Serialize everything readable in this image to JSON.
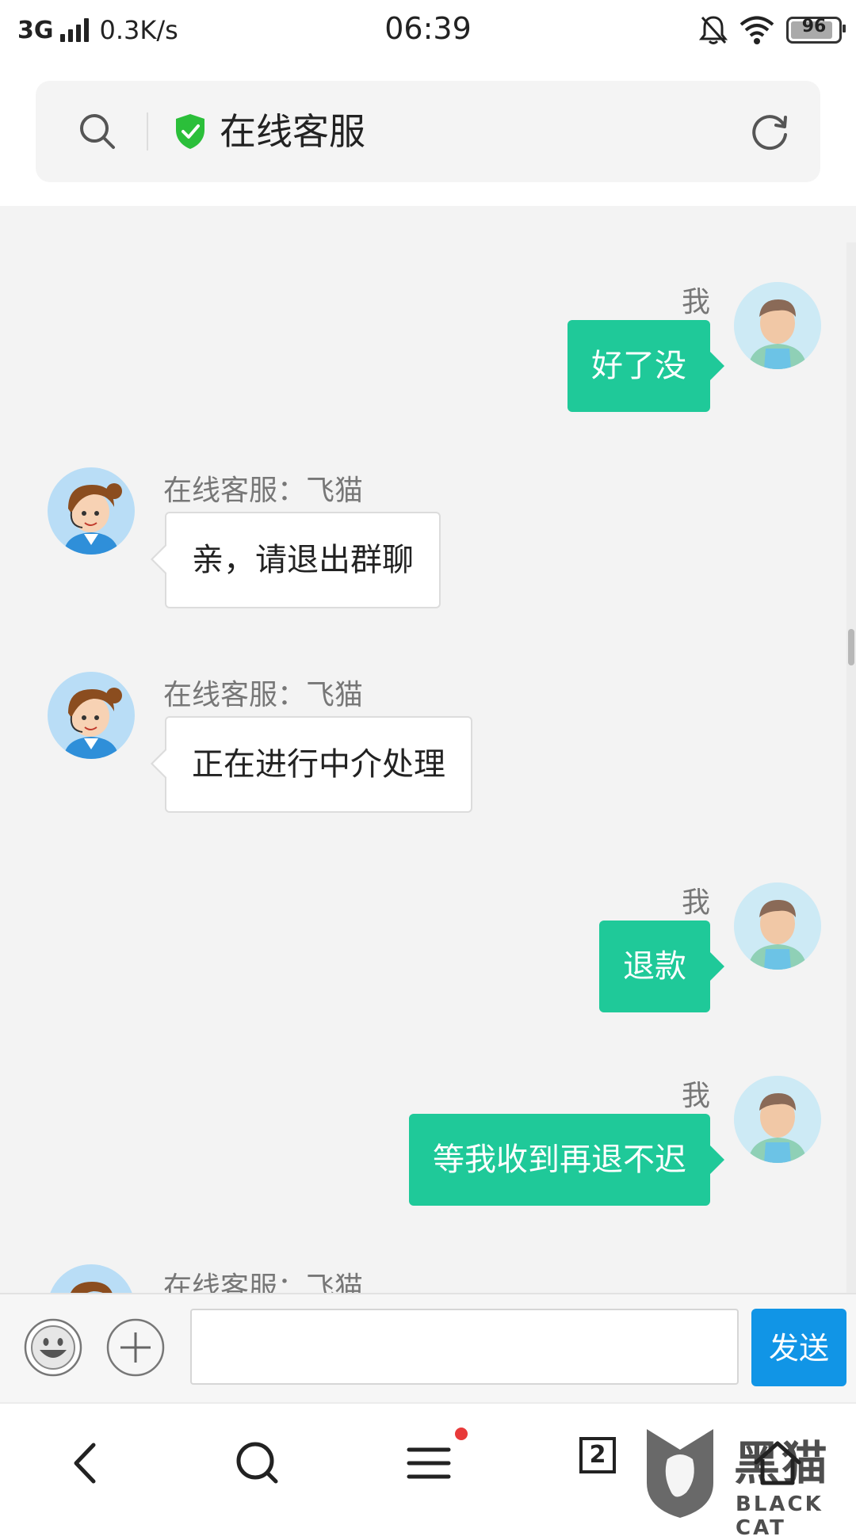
{
  "status_bar": {
    "network": "3G",
    "speed": "0.3K/s",
    "time": "06:39",
    "battery": "96",
    "icons": [
      "signal-icon",
      "bell-muted-icon",
      "wifi-icon",
      "battery-icon"
    ]
  },
  "address_bar": {
    "title": "在线客服",
    "icons": [
      "search-icon",
      "shield-check-icon",
      "refresh-icon"
    ],
    "shield_color": "#2bbf3a"
  },
  "chat": {
    "messages": [
      {
        "sender": "me",
        "name": "我",
        "text": "好了没"
      },
      {
        "sender": "agent",
        "name": "在线客服：飞猫",
        "text": "亲，请退出群聊"
      },
      {
        "sender": "agent",
        "name": "在线客服：飞猫",
        "text": "正在进行中介处理"
      },
      {
        "sender": "me",
        "name": "我",
        "text": "退款"
      },
      {
        "sender": "me",
        "name": "我",
        "text": "等我收到再退不迟"
      },
      {
        "sender": "agent",
        "name": "在线客服：飞猫",
        "text": ""
      }
    ],
    "colors": {
      "me_bubble": "#1fc999",
      "agent_bubble": "#ffffff",
      "background": "#f3f3f3"
    }
  },
  "input_bar": {
    "value": "",
    "placeholder": "",
    "send_label": "发送",
    "send_color": "#1195e6",
    "icons": [
      "emoji-icon",
      "plus-icon"
    ]
  },
  "bottom_nav": {
    "tab_count": "2",
    "icons": [
      "back-icon",
      "search-icon",
      "menu-icon",
      "tabs-icon",
      "home-icon"
    ],
    "notification_dot_color": "#e83a3a"
  },
  "watermark": {
    "title": "黑猫",
    "subtitle": "BLACK CAT"
  }
}
